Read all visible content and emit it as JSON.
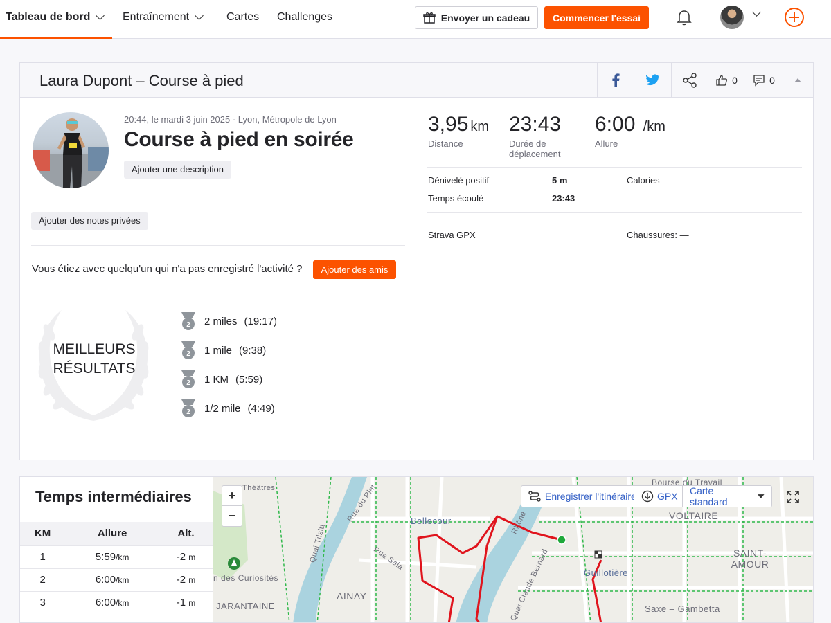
{
  "nav": {
    "items": [
      {
        "label": "Tableau de bord"
      },
      {
        "label": "Entraînement"
      },
      {
        "label": "Cartes"
      },
      {
        "label": "Challenges"
      }
    ],
    "gift_label": "Envoyer un cadeau",
    "trial_label": "Commencer l'essai"
  },
  "header": {
    "title": "Laura Dupont – Course à pied",
    "kudos_count": "0",
    "comment_count": "0"
  },
  "activity": {
    "meta": "20:44, le mardi 3 juin 2025 · Lyon, Métropole de Lyon",
    "title": "Course à pied en soirée",
    "description_btn": "Ajouter une description",
    "private_notes_btn": "Ajouter des notes privées",
    "friends_question": "Vous étiez avec quelqu'un qui n'a pas enregistré l'activité ?",
    "friends_btn": "Ajouter des amis"
  },
  "stats": {
    "distance_value": "3,95",
    "distance_unit": "km",
    "distance_label": "Distance",
    "moving_value": "23:43",
    "moving_label": "Durée de déplacement",
    "pace_value": "6:00",
    "pace_unit": "/km",
    "pace_label": "Allure",
    "elev_label": "Dénivelé positif",
    "elev_value": "5 m",
    "elapsed_label": "Temps écoulé",
    "elapsed_value": "23:43",
    "calories_label": "Calories",
    "calories_value": "—",
    "device": "Strava GPX",
    "shoes": "Chaussures: —"
  },
  "best_efforts": {
    "title": "MEILLEURS RÉSULTATS",
    "items": [
      {
        "rank": "2",
        "label": "2 miles",
        "time": "(19:17)"
      },
      {
        "rank": "2",
        "label": "1 mile",
        "time": "(9:38)"
      },
      {
        "rank": "2",
        "label": "1 KM",
        "time": "(5:59)"
      },
      {
        "rank": "2",
        "label": "1/2 mile",
        "time": "(4:49)"
      }
    ]
  },
  "splits": {
    "title": "Temps intermédiaires",
    "headers": [
      "KM",
      "Allure",
      "Alt."
    ],
    "rows": [
      {
        "km": "1",
        "pace": "5:59",
        "pace_unit": "/km",
        "alt": "-2",
        "alt_unit": "m"
      },
      {
        "km": "2",
        "pace": "6:00",
        "pace_unit": "/km",
        "alt": "-2",
        "alt_unit": "m"
      },
      {
        "km": "3",
        "pace": "6:00",
        "pace_unit": "/km",
        "alt": "-1",
        "alt_unit": "m"
      }
    ]
  },
  "map": {
    "route_btn": "Enregistrer l'itinéraire",
    "gpx_btn": "GPX",
    "style_btn": "Carte standard",
    "labels": {
      "bellecour": "Bellecour",
      "ainay": "AINAY",
      "voltaire": "VOLTAIRE",
      "saint_amour": "SAINT-AMOUR",
      "guillotiere": "Guillotière",
      "saxe": "Saxe – Gambetta",
      "bourse": "Bourse du Travail",
      "curiosites": "n des Curiosités",
      "jarantaine": "JARANTAINE",
      "quai_tilsitt": "Quai Tilsitt",
      "rue_plat": "Rue du Plat",
      "rue_sala": "Rue Sala",
      "quai_bernard": "Quai Claude Bernard",
      "theatres": "Théâtres",
      "rhone": "Rhône"
    }
  },
  "colors": {
    "brand": "#fc5200",
    "route": "#e0141d",
    "water": "#aad3df"
  }
}
